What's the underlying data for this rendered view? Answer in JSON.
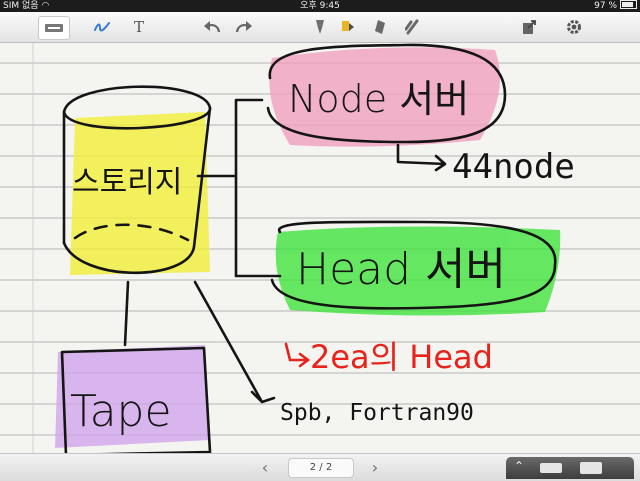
{
  "status_bar": {
    "carrier": "SIM 없음",
    "time": "오후 9:45",
    "battery": "97 %"
  },
  "toolbar": {
    "tools": [
      {
        "icon": "keyboard-icon"
      },
      {
        "icon": "pen-icon",
        "color": "#3a7bd5"
      },
      {
        "icon": "text-tool-icon",
        "label": "T"
      },
      {
        "icon": "undo-icon"
      },
      {
        "icon": "redo-icon"
      },
      {
        "icon": "pen-nib-icon"
      },
      {
        "icon": "highlighter-icon"
      },
      {
        "icon": "eraser-icon"
      },
      {
        "icon": "selection-icon"
      },
      {
        "icon": "share-icon"
      },
      {
        "icon": "gear-icon"
      }
    ]
  },
  "note": {
    "storage_label": "스토리지",
    "tape_label": "Tape",
    "node_label": "Node 서버",
    "node_note": "44node",
    "head_label": "Head 서버",
    "head_note": "2ea의 Head",
    "compiler_note": "Spb, Fortran90",
    "colors": {
      "ink": "#151515",
      "red_ink": "#e8231c",
      "yellow_highlight": "#f1ee33",
      "pink_highlight": "#ef9dbd",
      "green_highlight": "#3ee33a",
      "purple_highlight": "#cfa3ec",
      "ruled_line": "#b5b5b5"
    }
  },
  "footer": {
    "page_indicator": "2 / 2",
    "prev_icon": "chevron-left-icon",
    "next_icon": "chevron-right-icon",
    "tray_icons": [
      "chevron-up-icon",
      "keyboard-small-icon",
      "keyboard-hide-icon"
    ]
  }
}
